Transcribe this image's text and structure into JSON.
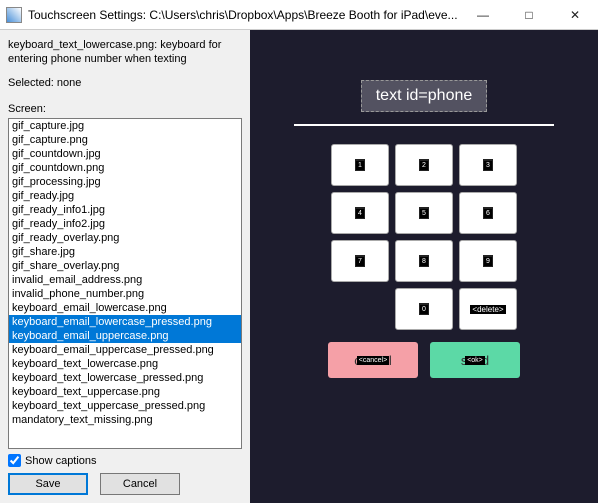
{
  "window": {
    "title": "Touchscreen Settings: C:\\Users\\chris\\Dropbox\\Apps\\Breeze Booth for iPad\\eve..."
  },
  "left": {
    "description": "keyboard_text_lowercase.png: keyboard for entering phone number when texting",
    "selected_label": "Selected: none",
    "screen_label": "Screen:",
    "show_captions_label": "Show captions",
    "show_captions_checked": true,
    "buttons": {
      "save": "Save",
      "cancel": "Cancel"
    },
    "list": {
      "highlighted": [
        14,
        15
      ],
      "items": [
        "gif_capture.jpg",
        "gif_capture.png",
        "gif_countdown.jpg",
        "gif_countdown.png",
        "gif_processing.jpg",
        "gif_ready.jpg",
        "gif_ready_info1.jpg",
        "gif_ready_info2.jpg",
        "gif_ready_overlay.png",
        "gif_share.jpg",
        "gif_share_overlay.png",
        "invalid_email_address.png",
        "invalid_phone_number.png",
        "keyboard_email_lowercase.png",
        "keyboard_email_lowercase_pressed.png",
        "keyboard_email_uppercase.png",
        "keyboard_email_uppercase_pressed.png",
        "keyboard_text_lowercase.png",
        "keyboard_text_lowercase_pressed.png",
        "keyboard_text_uppercase.png",
        "keyboard_text_uppercase_pressed.png",
        "mandatory_text_missing.png"
      ]
    }
  },
  "preview": {
    "text_id": "text id=phone",
    "keys": {
      "k1": "1",
      "k2": "2",
      "k3": "3",
      "k4": "4",
      "k5": "5",
      "k6": "6",
      "k7": "7",
      "k8": "8",
      "k9": "9",
      "kempty": "",
      "k0": "0",
      "kdel": "<delete>"
    },
    "actions": {
      "cancel_text": "cancel",
      "cancel_tag": "<cancel>",
      "send_text": "send",
      "send_tag": "<ok>"
    }
  }
}
